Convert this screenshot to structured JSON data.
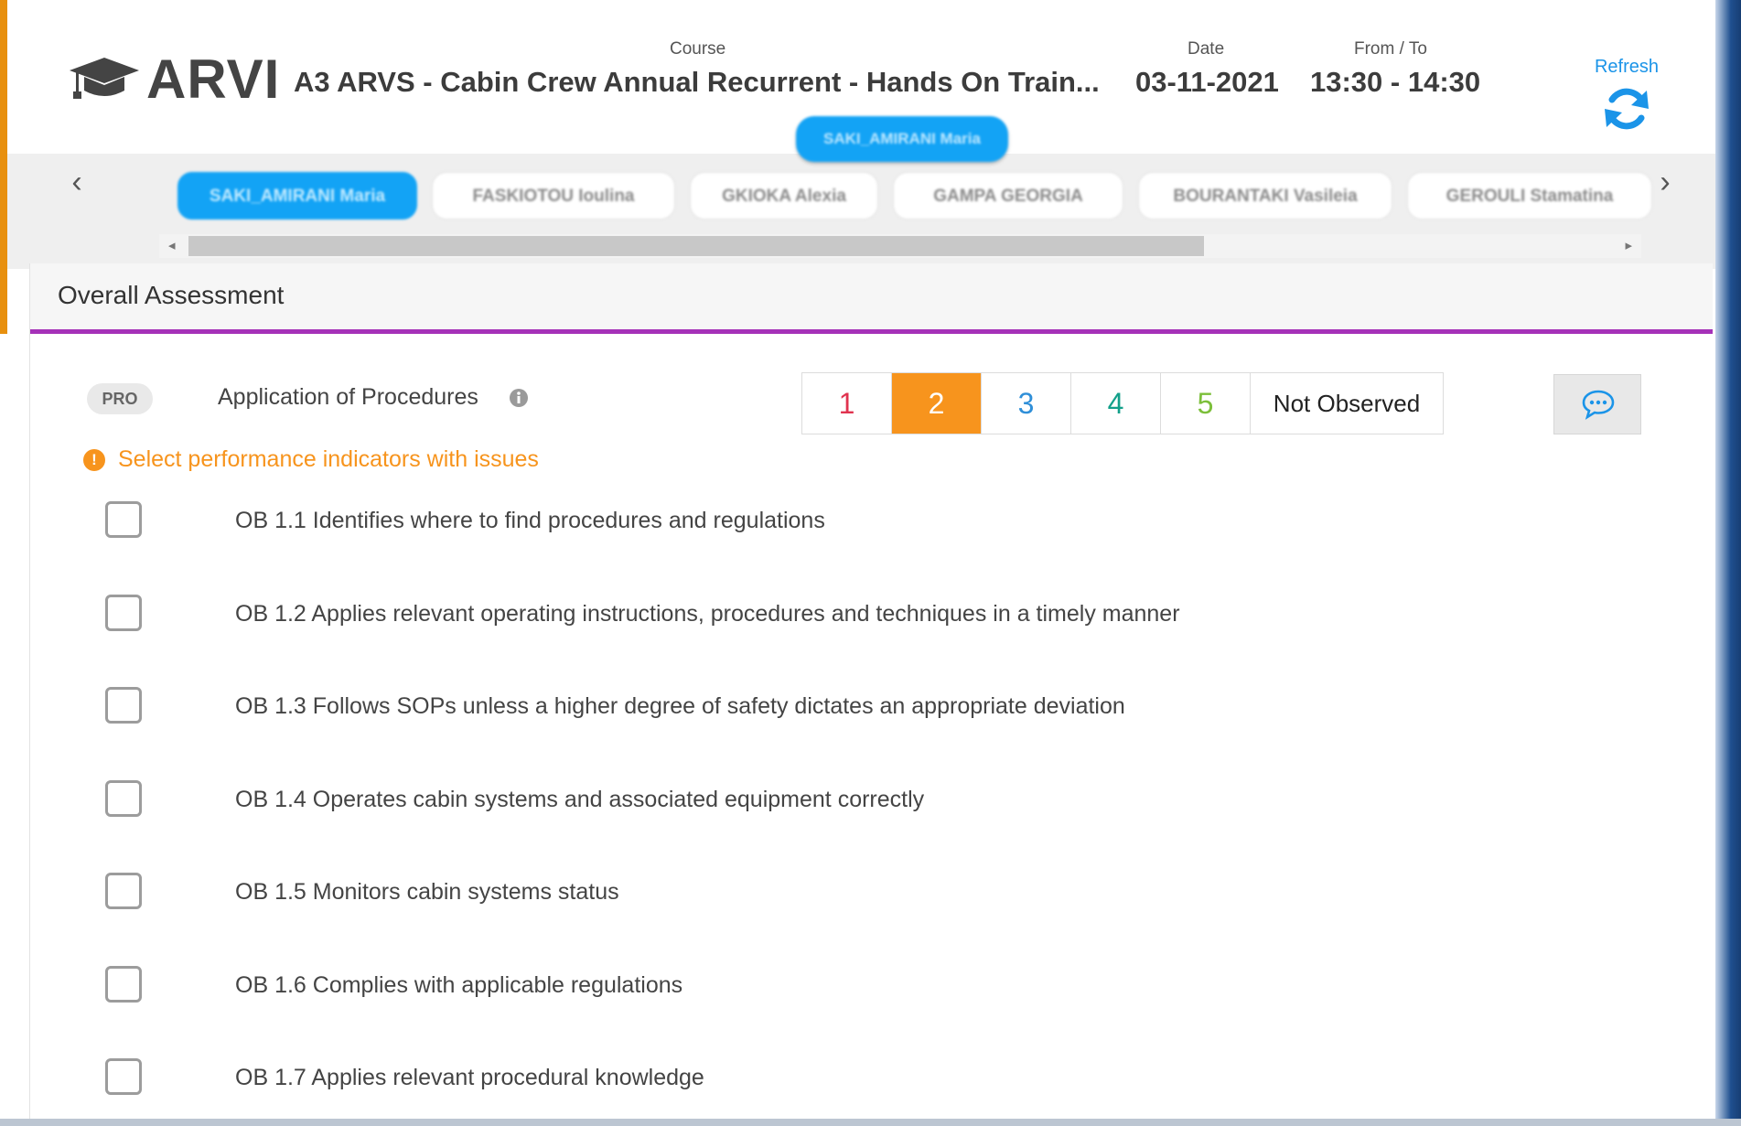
{
  "app": {
    "brand": "ARVI"
  },
  "header": {
    "course_label": "Course",
    "course_value": "A3 ARVS - Cabin Crew Annual Recurrent - Hands On Train...",
    "date_label": "Date",
    "date_value": "03-11-2021",
    "time_label": "From / To",
    "time_value": "13:30 - 14:30",
    "refresh_label": "Refresh",
    "current_trainee": "SAKI_AMIRANI Maria"
  },
  "trainees": [
    {
      "name": "SAKI_AMIRANI Maria",
      "active": true
    },
    {
      "name": "FASKIOTOU Ioulina",
      "active": false
    },
    {
      "name": "GKIOKA Alexia",
      "active": false
    },
    {
      "name": "GAMPA GEORGIA",
      "active": false
    },
    {
      "name": "BOURANTAKI Vasileia",
      "active": false
    },
    {
      "name": "GEROULI Stamatina",
      "active": false
    }
  ],
  "assessment": {
    "section_title": "Overall Assessment",
    "competency_code": "PRO",
    "competency_name": "Application of Procedures",
    "ratings": [
      {
        "label": "1",
        "color": "#e0334f"
      },
      {
        "label": "2",
        "color": "#f7941d",
        "selected": true
      },
      {
        "label": "3",
        "color": "#2f8fd8"
      },
      {
        "label": "4",
        "color": "#13a08a"
      },
      {
        "label": "5",
        "color": "#7cbf3a"
      },
      {
        "label": "Not Observed",
        "color": "#222222"
      }
    ],
    "warning": "Select performance indicators with issues",
    "indicators": [
      {
        "label": "OB 1.1 Identifies where to find procedures and regulations",
        "checked": false
      },
      {
        "label": "OB 1.2 Applies relevant operating instructions, procedures and techniques in a timely manner",
        "checked": false
      },
      {
        "label": "OB 1.3 Follows SOPs unless a higher degree of safety dictates an appropriate deviation",
        "checked": false
      },
      {
        "label": "OB 1.4 Operates cabin systems and associated equipment correctly",
        "checked": false
      },
      {
        "label": "OB 1.5 Monitors cabin systems status",
        "checked": false
      },
      {
        "label": "OB 1.6 Complies with applicable regulations",
        "checked": false
      },
      {
        "label": "OB 1.7 Applies relevant procedural knowledge",
        "checked": false
      }
    ]
  },
  "colors": {
    "accent_blue": "#13a3f5",
    "selected_orange": "#f7941d",
    "divider_purple": "#a531b8"
  }
}
